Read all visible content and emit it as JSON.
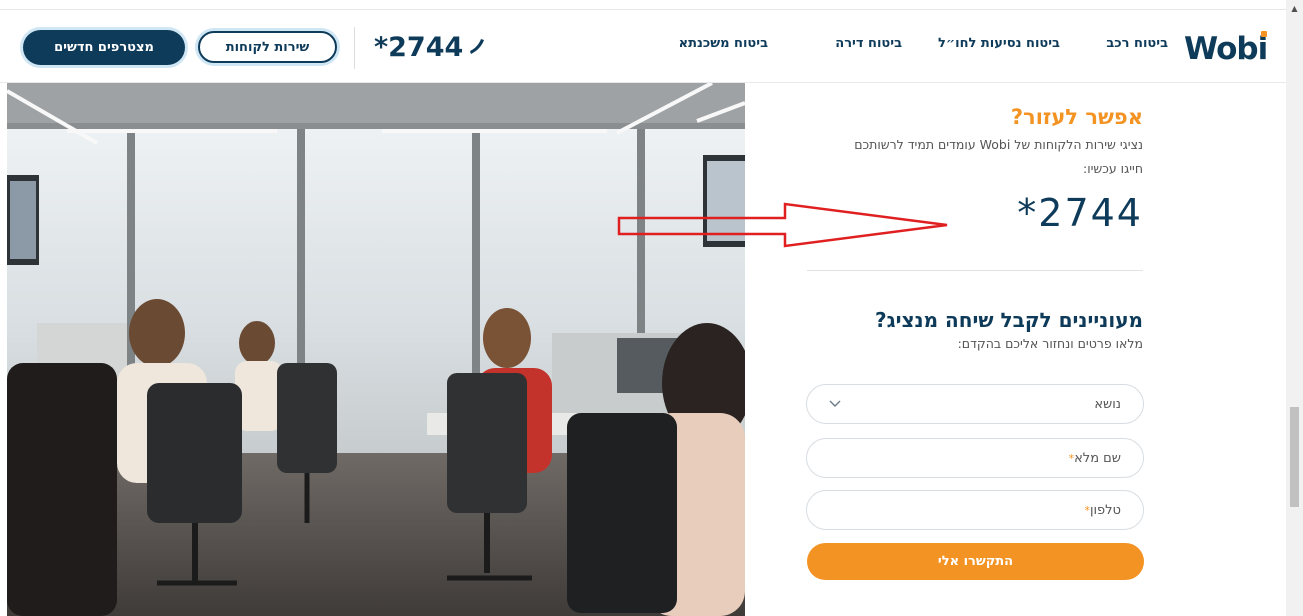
{
  "header": {
    "join_button": "מצטרפים חדשים",
    "service_button": "שירות לקוחות",
    "phone": "*2744",
    "nav": [
      "ביטוח רכב",
      "ביטוח נסיעות לחו״ל",
      "ביטוח דירה",
      "ביטוח משכנתא"
    ],
    "logo": "Wobi"
  },
  "help": {
    "title": "אפשר לעזור?",
    "text_line1": "נציגי שירות הלקוחות של Wobi עומדים תמיד לרשותכם",
    "text_line2": "חייגו עכשיו:",
    "phone": "*2744"
  },
  "callback": {
    "title": "מעוניינים לקבל שיחה מנציג?",
    "subtitle": "מלאו פרטים ונחזור אליכם בהקדם:",
    "topic_placeholder": "נושא",
    "name_placeholder": "שם מלא",
    "phone_placeholder": "טלפון",
    "required_mark": "*",
    "submit": "התקשרו אלי"
  },
  "colors": {
    "brand_navy": "#0f3b5a",
    "accent_orange": "#f39323",
    "annotation_red": "#e02020"
  }
}
